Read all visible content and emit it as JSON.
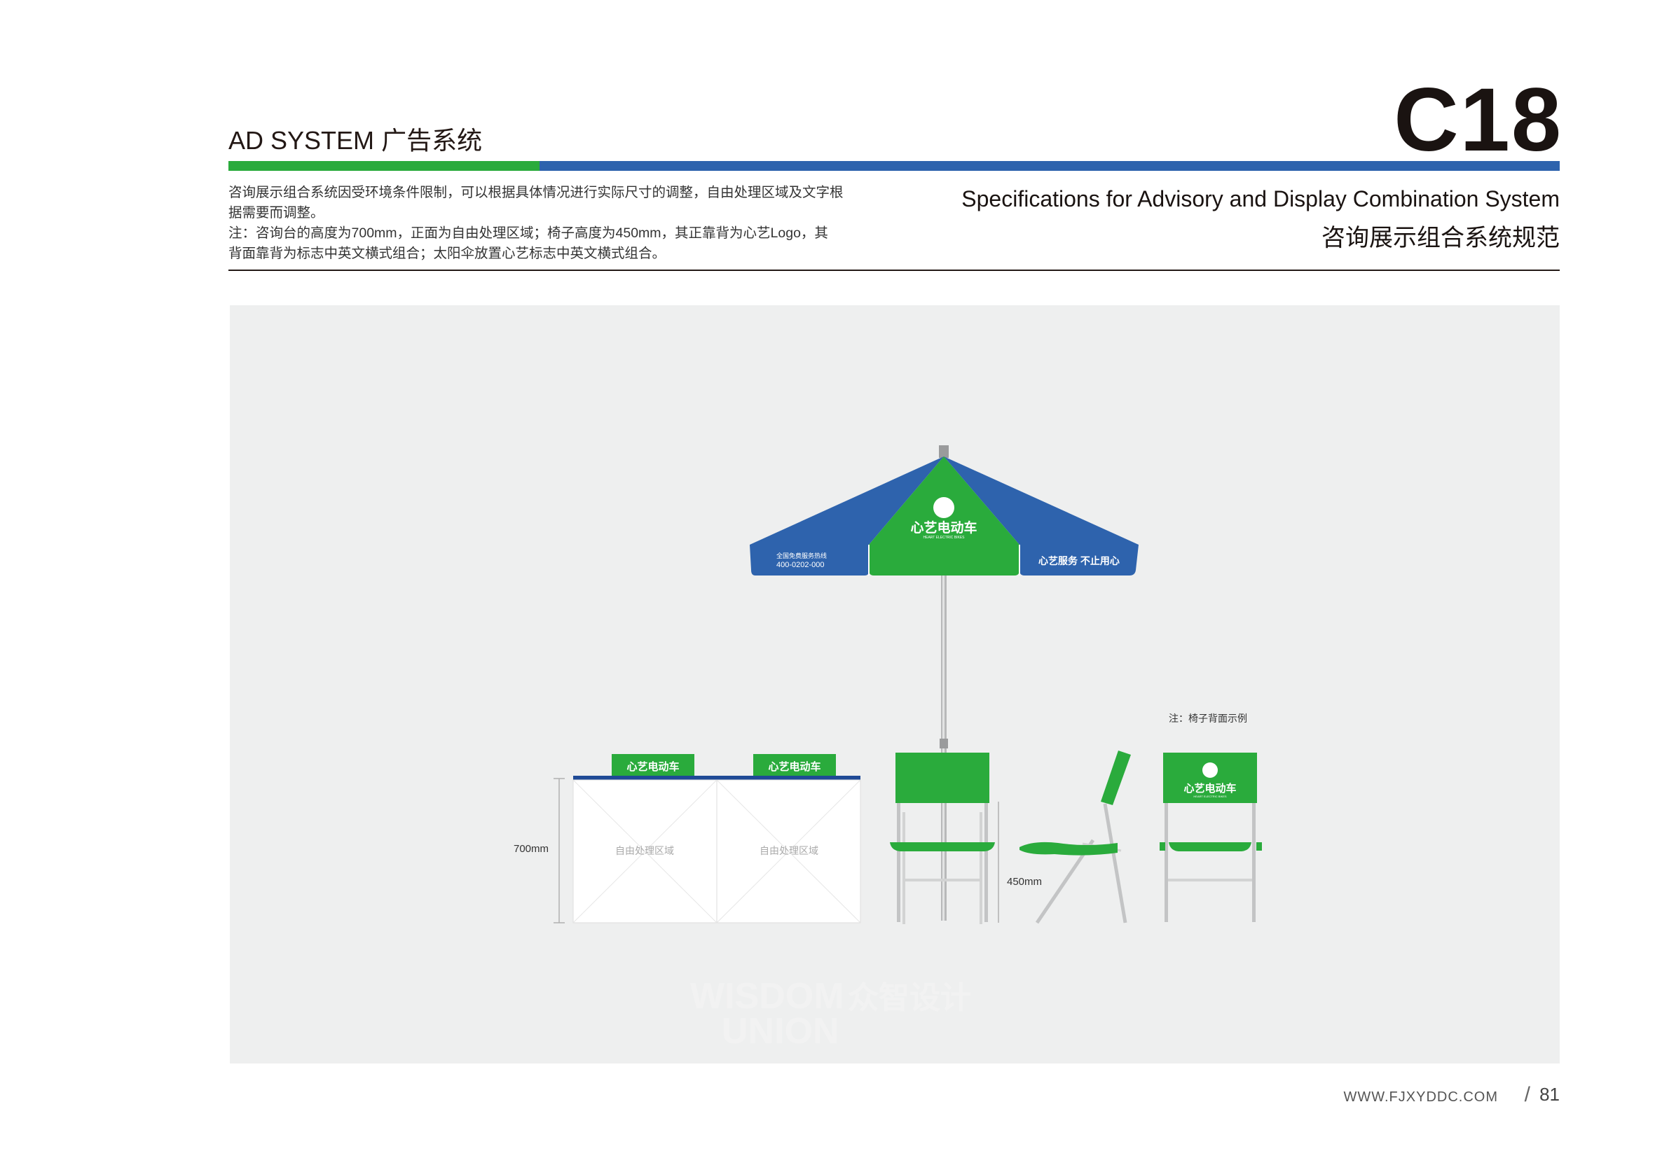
{
  "header": {
    "section_en": "AD SYSTEM",
    "section_zh": "广告系统",
    "code": "C18"
  },
  "description": {
    "line1": "咨询展示组合系统因受环境条件限制，可以根据具体情况进行实际尺寸的调整，自由处理区域及文字根",
    "line2": "据需要而调整。",
    "line3": "注：咨询台的高度为700mm，正面为自由处理区域；椅子高度为450mm，其正靠背为心艺Logo，其",
    "line4": "背面靠背为标志中英文横式组合；太阳伞放置心艺标志中英文横式组合。"
  },
  "spec": {
    "title_en": "Specifications for   Advisory and Display Combination System",
    "title_zh": "咨询展示组合系统规范"
  },
  "illustration": {
    "umbrella": {
      "brand_cn": "心艺电动车",
      "brand_en": "HEART ELECTRIC BIKES",
      "hotline_label": "全国免费服务热线",
      "hotline_number": "400-0202-000",
      "slogan": "心艺服务 不止用心"
    },
    "table": {
      "height_label": "700mm",
      "free_area_label_1": "自由处理区域",
      "free_area_label_2": "自由处理区域",
      "sign_1": "心艺电动车",
      "sign_2": "心艺电动车"
    },
    "chair": {
      "height_label": "450mm",
      "back_note": "注：椅子背面示例",
      "back_brand_cn": "心艺电动车",
      "back_brand_en": "HEART ELECTRIC BIKES"
    },
    "watermark": {
      "line1": "WISDOM",
      "line2": "UNION",
      "zh": "众智设计"
    }
  },
  "footer": {
    "url": "WWW.FJXYDDC.COM",
    "slash": "/",
    "page": "81"
  },
  "colors": {
    "brand_green": "#2aab3c",
    "brand_blue": "#2e63ad",
    "panel_bg": "#eeefef"
  }
}
